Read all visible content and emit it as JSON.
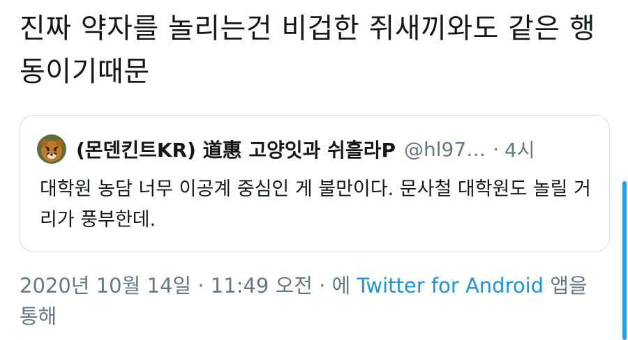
{
  "tweet": {
    "text": "진짜 약자를 놀리는건 비겁한 쥐새끼와도 같은 행동이기때문"
  },
  "quoted_tweet": {
    "author_name": "(몬덴킨트KR) 道惠 고양잇과 쉬흘라P",
    "handle": "@hl97…",
    "separator": "·",
    "time": "4시",
    "text": "대학원 농담 너무 이공계 중심인 게 불만이다. 문사철 대학원도 놀릴 거리가 풍부한데."
  },
  "meta": {
    "timestamp": "2020년 10월 14일 · 11:49 오전 · 에",
    "source_link": "Twitter for Android",
    "suffix": "앱을 통해"
  },
  "colors": {
    "text": "#14171a",
    "secondary": "#657786",
    "link": "#1b95e0",
    "border": "#d6dde3",
    "scrollbar": "#1da1f2"
  },
  "icons": {
    "avatar": "tiger-avatar"
  }
}
